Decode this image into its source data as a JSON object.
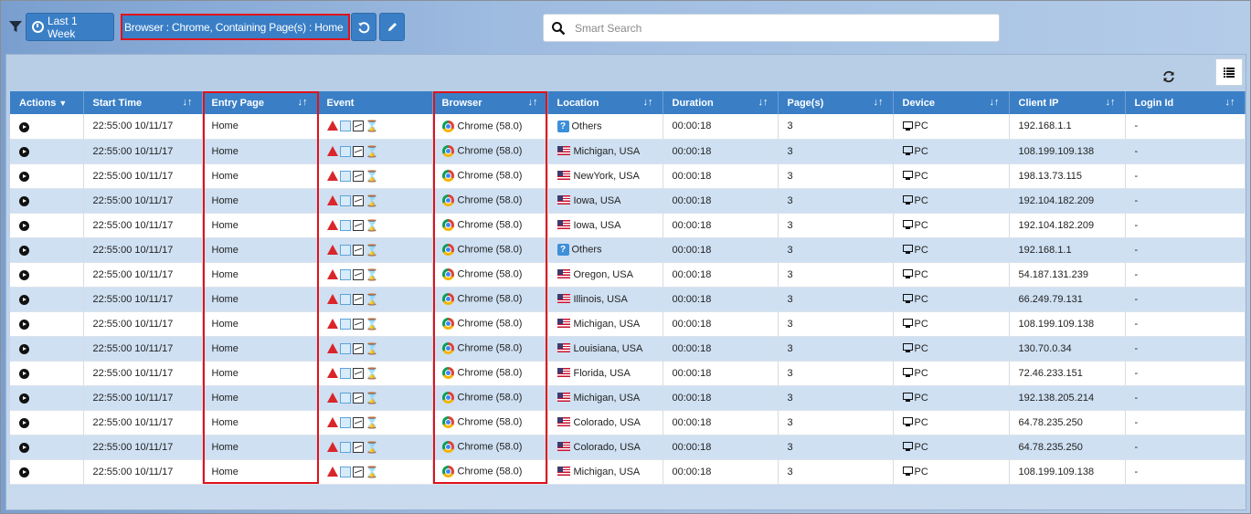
{
  "toolbar": {
    "date_range_label": "Last 1 Week",
    "filter_tag": "Browser : Chrome, Containing Page(s) : Home",
    "search_placeholder": "Smart Search"
  },
  "colors": {
    "accent": "#3a7fc6",
    "highlight": "#e0121b",
    "row_alt": "#cfe0f2"
  },
  "table": {
    "columns": [
      {
        "label": "Actions"
      },
      {
        "label": "Start Time"
      },
      {
        "label": "Entry Page"
      },
      {
        "label": "Event"
      },
      {
        "label": "Browser"
      },
      {
        "label": "Location"
      },
      {
        "label": "Duration"
      },
      {
        "label": "Page(s)"
      },
      {
        "label": "Device"
      },
      {
        "label": "Client IP"
      },
      {
        "label": "Login Id"
      }
    ],
    "rows": [
      {
        "start": "22:55:00 10/11/17",
        "entry": "Home",
        "browser": "Chrome (58.0)",
        "location": "Others",
        "loc_type": "unknown",
        "duration": "00:00:18",
        "pages": "3",
        "device": "PC",
        "ip": "192.168.1.1",
        "login": "-"
      },
      {
        "start": "22:55:00 10/11/17",
        "entry": "Home",
        "browser": "Chrome (58.0)",
        "location": "Michigan, USA",
        "loc_type": "us",
        "duration": "00:00:18",
        "pages": "3",
        "device": "PC",
        "ip": "108.199.109.138",
        "login": "-"
      },
      {
        "start": "22:55:00 10/11/17",
        "entry": "Home",
        "browser": "Chrome (58.0)",
        "location": "NewYork, USA",
        "loc_type": "us",
        "duration": "00:00:18",
        "pages": "3",
        "device": "PC",
        "ip": "198.13.73.115",
        "login": "-"
      },
      {
        "start": "22:55:00 10/11/17",
        "entry": "Home",
        "browser": "Chrome (58.0)",
        "location": "Iowa, USA",
        "loc_type": "us",
        "duration": "00:00:18",
        "pages": "3",
        "device": "PC",
        "ip": "192.104.182.209",
        "login": "-"
      },
      {
        "start": "22:55:00 10/11/17",
        "entry": "Home",
        "browser": "Chrome (58.0)",
        "location": "Iowa, USA",
        "loc_type": "us",
        "duration": "00:00:18",
        "pages": "3",
        "device": "PC",
        "ip": "192.104.182.209",
        "login": "-"
      },
      {
        "start": "22:55:00 10/11/17",
        "entry": "Home",
        "browser": "Chrome (58.0)",
        "location": "Others",
        "loc_type": "unknown",
        "duration": "00:00:18",
        "pages": "3",
        "device": "PC",
        "ip": "192.168.1.1",
        "login": "-"
      },
      {
        "start": "22:55:00 10/11/17",
        "entry": "Home",
        "browser": "Chrome (58.0)",
        "location": "Oregon, USA",
        "loc_type": "us",
        "duration": "00:00:18",
        "pages": "3",
        "device": "PC",
        "ip": "54.187.131.239",
        "login": "-"
      },
      {
        "start": "22:55:00 10/11/17",
        "entry": "Home",
        "browser": "Chrome (58.0)",
        "location": "Illinois, USA",
        "loc_type": "us",
        "duration": "00:00:18",
        "pages": "3",
        "device": "PC",
        "ip": "66.249.79.131",
        "login": "-"
      },
      {
        "start": "22:55:00 10/11/17",
        "entry": "Home",
        "browser": "Chrome (58.0)",
        "location": "Michigan, USA",
        "loc_type": "us",
        "duration": "00:00:18",
        "pages": "3",
        "device": "PC",
        "ip": "108.199.109.138",
        "login": "-"
      },
      {
        "start": "22:55:00 10/11/17",
        "entry": "Home",
        "browser": "Chrome (58.0)",
        "location": "Louisiana, USA",
        "loc_type": "us",
        "duration": "00:00:18",
        "pages": "3",
        "device": "PC",
        "ip": "130.70.0.34",
        "login": "-"
      },
      {
        "start": "22:55:00 10/11/17",
        "entry": "Home",
        "browser": "Chrome (58.0)",
        "location": "Florida, USA",
        "loc_type": "us",
        "duration": "00:00:18",
        "pages": "3",
        "device": "PC",
        "ip": "72.46.233.151",
        "login": "-"
      },
      {
        "start": "22:55:00 10/11/17",
        "entry": "Home",
        "browser": "Chrome (58.0)",
        "location": "Michigan, USA",
        "loc_type": "us",
        "duration": "00:00:18",
        "pages": "3",
        "device": "PC",
        "ip": "192.138.205.214",
        "login": "-"
      },
      {
        "start": "22:55:00 10/11/17",
        "entry": "Home",
        "browser": "Chrome (58.0)",
        "location": "Colorado, USA",
        "loc_type": "us",
        "duration": "00:00:18",
        "pages": "3",
        "device": "PC",
        "ip": "64.78.235.250",
        "login": "-"
      },
      {
        "start": "22:55:00 10/11/17",
        "entry": "Home",
        "browser": "Chrome (58.0)",
        "location": "Colorado, USA",
        "loc_type": "us",
        "duration": "00:00:18",
        "pages": "3",
        "device": "PC",
        "ip": "64.78.235.250",
        "login": "-"
      },
      {
        "start": "22:55:00 10/11/17",
        "entry": "Home",
        "browser": "Chrome (58.0)",
        "location": "Michigan, USA",
        "loc_type": "us",
        "duration": "00:00:18",
        "pages": "3",
        "device": "PC",
        "ip": "108.199.109.138",
        "login": "-"
      }
    ]
  }
}
